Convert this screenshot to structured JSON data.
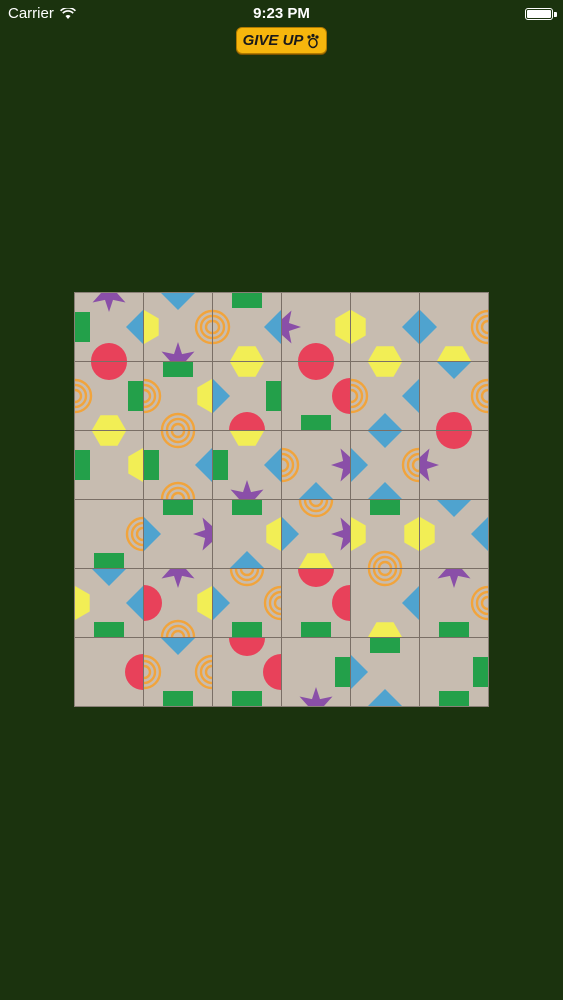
{
  "status_bar": {
    "carrier": "Carrier",
    "time": "9:23 PM",
    "battery_level": 1.0
  },
  "give_up_button": {
    "label": "GIVE UP"
  },
  "colors": {
    "background": "#1b330e",
    "tile": "#c7bcb0",
    "purple-star": "#8a4fa8",
    "blue-diamond": "#4fa3cf",
    "green-square": "#23a04a",
    "yellow-hexagon": "#f2ee55",
    "red-circle": "#e8415a",
    "orange-spiral": "#f1a43c",
    "button": "#f6b60d"
  },
  "board": {
    "rows": 6,
    "cols": 6,
    "tiles": [
      [
        {
          "top": "purple-star",
          "right": "blue-diamond",
          "bottom": "red-circle",
          "left": "green-square"
        },
        {
          "top": "blue-diamond",
          "right": "orange-spiral",
          "bottom": "purple-star",
          "left": "yellow-hexagon"
        },
        {
          "top": "green-square",
          "right": "blue-diamond",
          "bottom": "yellow-hexagon",
          "left": "orange-spiral"
        },
        {
          "top": "none",
          "right": "yellow-hexagon",
          "bottom": "red-circle",
          "left": "purple-star"
        },
        {
          "top": "none",
          "right": "blue-diamond",
          "bottom": "yellow-hexagon",
          "left": "yellow-hexagon"
        },
        {
          "top": "none",
          "right": "orange-spiral",
          "bottom": "yellow-hexagon",
          "left": "blue-diamond"
        }
      ],
      [
        {
          "top": "red-circle",
          "right": "green-square",
          "bottom": "yellow-hexagon",
          "left": "orange-spiral"
        },
        {
          "top": "green-square",
          "right": "yellow-hexagon",
          "bottom": "orange-spiral",
          "left": "orange-spiral"
        },
        {
          "top": "yellow-hexagon",
          "right": "green-square",
          "bottom": "red-circle",
          "left": "blue-diamond"
        },
        {
          "top": "red-circle",
          "right": "red-circle",
          "bottom": "green-square",
          "left": "none"
        },
        {
          "top": "yellow-hexagon",
          "right": "blue-diamond",
          "bottom": "blue-diamond",
          "left": "orange-spiral"
        },
        {
          "top": "blue-diamond",
          "right": "orange-spiral",
          "bottom": "red-circle",
          "left": "none"
        }
      ],
      [
        {
          "top": "yellow-hexagon",
          "right": "yellow-hexagon",
          "bottom": "none",
          "left": "green-square"
        },
        {
          "top": "orange-spiral",
          "right": "blue-diamond",
          "bottom": "orange-spiral",
          "left": "green-square"
        },
        {
          "top": "yellow-hexagon",
          "right": "blue-diamond",
          "bottom": "purple-star",
          "left": "green-square"
        },
        {
          "top": "none",
          "right": "purple-star",
          "bottom": "blue-diamond",
          "left": "orange-spiral"
        },
        {
          "top": "blue-diamond",
          "right": "orange-spiral",
          "bottom": "blue-diamond",
          "left": "blue-diamond"
        },
        {
          "top": "red-circle",
          "right": "none",
          "bottom": "none",
          "left": "purple-star"
        }
      ],
      [
        {
          "top": "none",
          "right": "orange-spiral",
          "bottom": "green-square",
          "left": "none"
        },
        {
          "top": "green-square",
          "right": "purple-star",
          "bottom": "none",
          "left": "blue-diamond"
        },
        {
          "top": "green-square",
          "right": "yellow-hexagon",
          "bottom": "blue-diamond",
          "left": "none"
        },
        {
          "top": "orange-spiral",
          "right": "purple-star",
          "bottom": "yellow-hexagon",
          "left": "blue-diamond"
        },
        {
          "top": "green-square",
          "right": "yellow-hexagon",
          "bottom": "orange-spiral",
          "left": "yellow-hexagon"
        },
        {
          "top": "blue-diamond",
          "right": "blue-diamond",
          "bottom": "none",
          "left": "yellow-hexagon"
        }
      ],
      [
        {
          "top": "blue-diamond",
          "right": "blue-diamond",
          "bottom": "green-square",
          "left": "yellow-hexagon"
        },
        {
          "top": "purple-star",
          "right": "yellow-hexagon",
          "bottom": "orange-spiral",
          "left": "red-circle"
        },
        {
          "top": "orange-spiral",
          "right": "orange-spiral",
          "bottom": "green-square",
          "left": "blue-diamond"
        },
        {
          "top": "red-circle",
          "right": "red-circle",
          "bottom": "green-square",
          "left": "none"
        },
        {
          "top": "orange-spiral",
          "right": "blue-diamond",
          "bottom": "yellow-hexagon",
          "left": "none"
        },
        {
          "top": "purple-star",
          "right": "orange-spiral",
          "bottom": "green-square",
          "left": "none"
        }
      ],
      [
        {
          "top": "none",
          "right": "red-circle",
          "bottom": "none",
          "left": "none"
        },
        {
          "top": "blue-diamond",
          "right": "orange-spiral",
          "bottom": "green-square",
          "left": "orange-spiral"
        },
        {
          "top": "red-circle",
          "right": "red-circle",
          "bottom": "green-square",
          "left": "none"
        },
        {
          "top": "none",
          "right": "green-square",
          "bottom": "purple-star",
          "left": "none"
        },
        {
          "top": "green-square",
          "right": "none",
          "bottom": "blue-diamond",
          "left": "blue-diamond"
        },
        {
          "top": "none",
          "right": "green-square",
          "bottom": "green-square",
          "left": "none"
        }
      ]
    ]
  }
}
